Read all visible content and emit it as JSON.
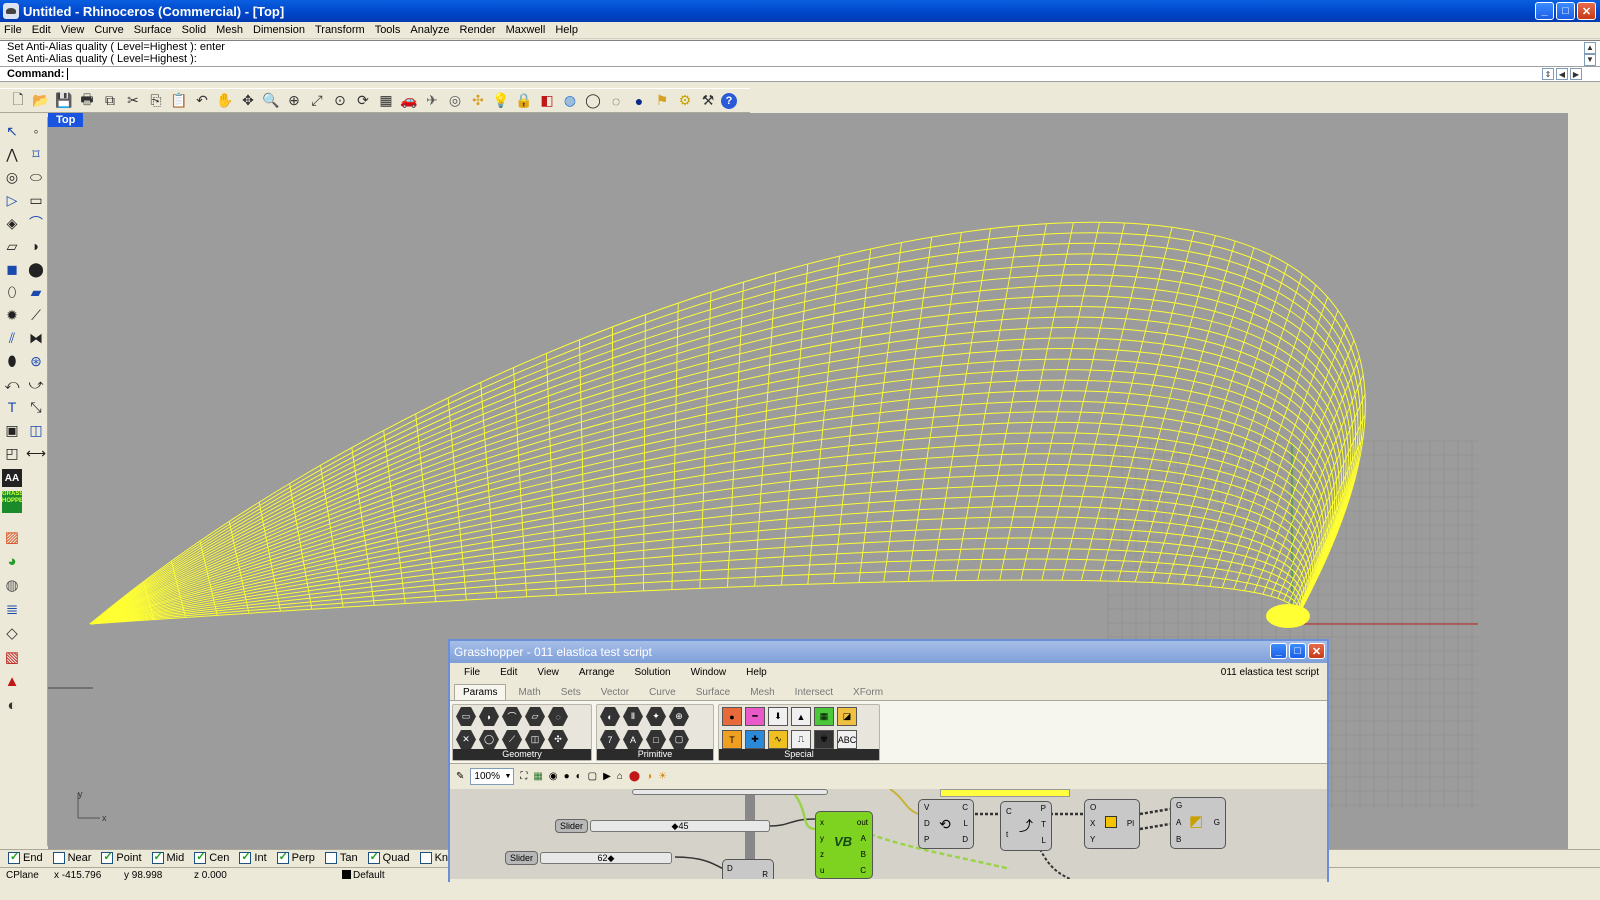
{
  "window": {
    "title": "Untitled - Rhinoceros (Commercial) - [Top]",
    "controls": {
      "minimize": "_",
      "maximize": "□",
      "close": "✕"
    }
  },
  "menu": [
    "File",
    "Edit",
    "View",
    "Curve",
    "Surface",
    "Solid",
    "Mesh",
    "Dimension",
    "Transform",
    "Tools",
    "Analyze",
    "Render",
    "Maxwell",
    "Help"
  ],
  "command_history": [
    "Set Anti-Alias quality ( Level=Highest ): enter",
    "Set Anti-Alias quality ( Level=Highest ):"
  ],
  "command": {
    "label": "Command:",
    "value": ""
  },
  "top_toolbar_icons": [
    "new-file-icon",
    "open-file-icon",
    "save-icon",
    "print-icon",
    "export-icon",
    "cut-icon",
    "copy-icon",
    "paste-icon",
    "undo-icon",
    "pan-hand-icon",
    "move-view-icon",
    "zoom-icon",
    "zoom-window-icon",
    "zoom-extents-icon",
    "zoom-selected-icon",
    "rotate-view-icon",
    "four-views-icon",
    "car-icon",
    "plane-icon",
    "point-icon",
    "select-icon",
    "light-icon",
    "lock-icon",
    "shade-icon",
    "color-wheel-icon",
    "wireframe-icon",
    "ghosted-icon",
    "render-sphere-icon",
    "flag-icon",
    "gear-icon",
    "properties-icon",
    "help-icon"
  ],
  "viewport": {
    "label": "Top",
    "axis_x": "x",
    "axis_y": "y",
    "accent": "#ffff33"
  },
  "osnaps": [
    {
      "label": "End",
      "checked": true
    },
    {
      "label": "Near",
      "checked": false
    },
    {
      "label": "Point",
      "checked": true
    },
    {
      "label": "Mid",
      "checked": true
    },
    {
      "label": "Cen",
      "checked": true
    },
    {
      "label": "Int",
      "checked": true
    },
    {
      "label": "Perp",
      "checked": true
    },
    {
      "label": "Tan",
      "checked": false
    },
    {
      "label": "Quad",
      "checked": true
    },
    {
      "label": "Knot",
      "checked": false
    }
  ],
  "status": {
    "cplane": "CPlane",
    "x": "x -415.796",
    "y": "y 98.998",
    "z": "z 0.000",
    "layer": "Default"
  },
  "left_tools": {
    "aa_label": "AA",
    "grasshopper_label": "GRASS HOPPE"
  },
  "grasshopper": {
    "title": "Grasshopper - 011 elastica test script",
    "menu": [
      "File",
      "Edit",
      "View",
      "Arrange",
      "Solution",
      "Window",
      "Help"
    ],
    "document": "011 elastica test script",
    "tabs": [
      {
        "label": "Params",
        "active": true
      },
      {
        "label": "Math",
        "active": false
      },
      {
        "label": "Sets",
        "active": false
      },
      {
        "label": "Vector",
        "active": false
      },
      {
        "label": "Curve",
        "active": false
      },
      {
        "label": "Surface",
        "active": false
      },
      {
        "label": "Mesh",
        "active": false
      },
      {
        "label": "Intersect",
        "active": false
      },
      {
        "label": "XForm",
        "active": false
      }
    ],
    "panels": [
      "Geometry",
      "Primitive",
      "Special"
    ],
    "zoom": "100%",
    "sliders": [
      {
        "label": "Slider",
        "value": "45"
      },
      {
        "label": "Slider",
        "value": "62"
      }
    ],
    "vb_node": {
      "title": "VB",
      "inputs": [
        "x",
        "y",
        "z",
        "u"
      ],
      "outputs": [
        "out",
        "A",
        "B",
        "C"
      ]
    },
    "nodes": [
      {
        "inputs": [
          "V",
          "D",
          "P"
        ],
        "outputs": [
          "C",
          "L",
          "D"
        ]
      },
      {
        "inputs": [
          "C",
          "t"
        ],
        "outputs": [
          "P",
          "T",
          "L"
        ]
      },
      {
        "inputs": [
          "O",
          "X",
          "Y"
        ],
        "outputs": [
          "Pl"
        ]
      },
      {
        "inputs": [
          "G",
          "A",
          "B"
        ],
        "outputs": [
          "G"
        ]
      }
    ],
    "partial_node_inputs": [
      "D"
    ],
    "partial_node_outputs": [
      "R"
    ]
  }
}
